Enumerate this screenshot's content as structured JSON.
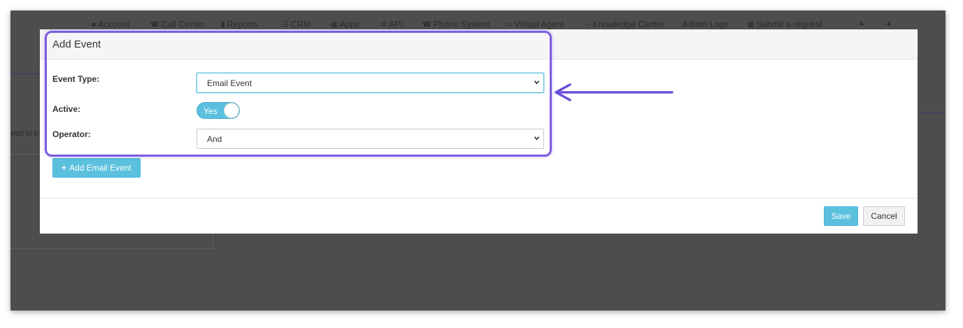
{
  "topnav": {
    "items": [
      {
        "label": "Account",
        "icon": "user-icon"
      },
      {
        "label": "Call Center",
        "icon": "phone-icon"
      },
      {
        "label": "Reports",
        "icon": "bar-chart-icon"
      },
      {
        "label": "CRM",
        "icon": "list-icon"
      },
      {
        "label": "Apps",
        "icon": "grid-icon"
      },
      {
        "label": "API",
        "icon": "gear-icon"
      },
      {
        "label": "Phone System",
        "icon": "phone-icon"
      },
      {
        "label": "Virtual Agent",
        "icon": "monitor-icon"
      },
      {
        "label": "Knowledge Center",
        "icon": "lightbulb-icon"
      },
      {
        "label": "Admin Logs",
        "icon": ""
      },
      {
        "label": "Submit a request",
        "icon": "ticket-icon"
      }
    ]
  },
  "background": {
    "partial_text": "eed to b"
  },
  "modal": {
    "title": "Add Event",
    "event_type_label": "Event Type:",
    "event_type_value": "Email Event",
    "active_label": "Active:",
    "active_toggle_text": "Yes",
    "active_value": true,
    "operator_label": "Operator:",
    "operator_value": "And",
    "add_button_label": "Add Email Event",
    "save_label": "Save",
    "cancel_label": "Cancel"
  },
  "colors": {
    "accent": "#5bc0de",
    "annotation": "#7b5ce1",
    "overlay": "#4d4d4d"
  }
}
